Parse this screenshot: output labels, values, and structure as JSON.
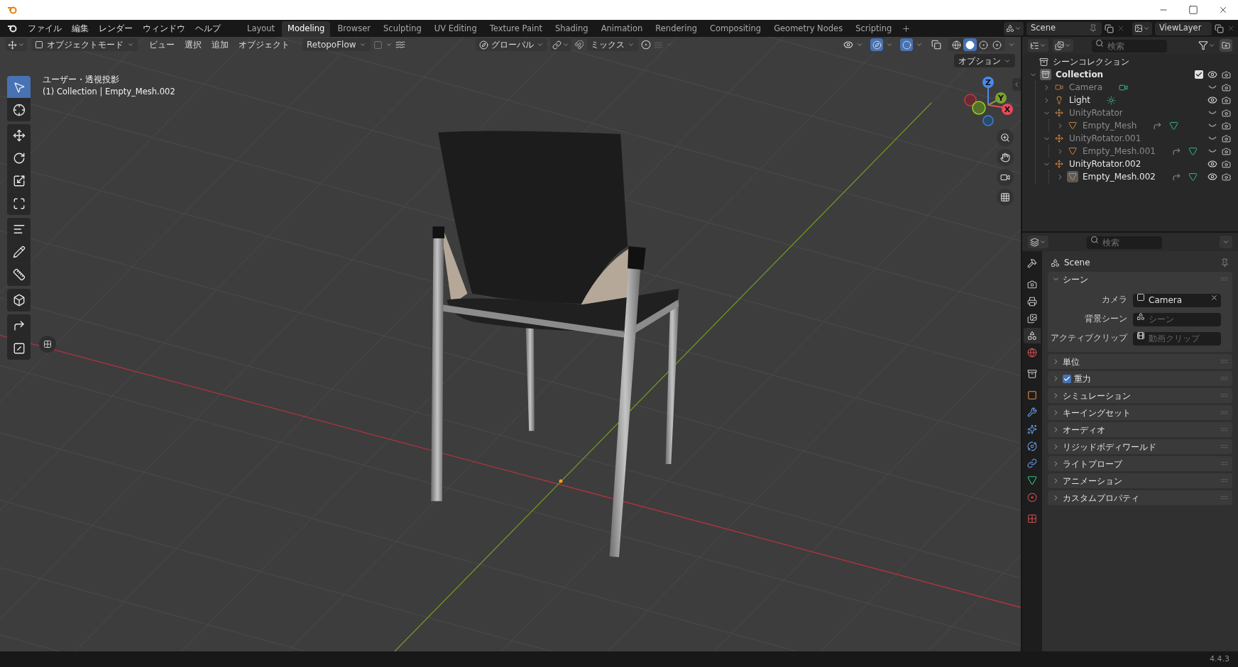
{
  "title_bar": {
    "controls": [
      {
        "kind": "minimize"
      },
      {
        "kind": "maximize"
      },
      {
        "kind": "close"
      }
    ]
  },
  "menu_bar": {
    "items": [
      "ファイル",
      "編集",
      "レンダー",
      "ウィンドウ",
      "ヘルプ"
    ]
  },
  "workspace_tabs": [
    {
      "label": "Layout",
      "selected": false
    },
    {
      "label": "Modeling",
      "selected": true
    },
    {
      "label": "Browser",
      "selected": false
    },
    {
      "label": "Sculpting",
      "selected": false
    },
    {
      "label": "UV Editing",
      "selected": false
    },
    {
      "label": "Texture Paint",
      "selected": false
    },
    {
      "label": "Shading",
      "selected": false
    },
    {
      "label": "Animation",
      "selected": false
    },
    {
      "label": "Rendering",
      "selected": false
    },
    {
      "label": "Compositing",
      "selected": false
    },
    {
      "label": "Geometry Nodes",
      "selected": false
    },
    {
      "label": "Scripting",
      "selected": false
    }
  ],
  "scene_selector": {
    "value": "Scene"
  },
  "view_layer_selector": {
    "value": "ViewLayer"
  },
  "viewport_header": {
    "mode": "オブジェクトモード",
    "menus": [
      "ビュー",
      "選択",
      "追加",
      "オブジェクト"
    ],
    "addon_menu": "RetopoFlow",
    "orientation": "グローバル",
    "pivot": "ミックス",
    "shading_modes": [
      {
        "kind": "wireframe",
        "selected": false
      },
      {
        "kind": "solid",
        "selected": true
      },
      {
        "kind": "material",
        "selected": false
      },
      {
        "kind": "rendered",
        "selected": false
      }
    ]
  },
  "viewport": {
    "view_name": "ユーザー・透視投影",
    "context": "(1) Collection | Empty_Mesh.002",
    "options": "オプション",
    "tool_groups": [
      [
        {
          "kind": "select",
          "selected": true
        },
        {
          "kind": "cursor",
          "selected": false
        }
      ],
      [
        {
          "kind": "move",
          "selected": false
        },
        {
          "kind": "rotate",
          "selected": false
        },
        {
          "kind": "scale",
          "selected": false
        },
        {
          "kind": "transform",
          "selected": false
        }
      ],
      [
        {
          "kind": "align",
          "selected": false
        },
        {
          "kind": "annotate",
          "selected": false
        },
        {
          "kind": "measure",
          "selected": false
        }
      ],
      [
        {
          "kind": "add_cube",
          "selected": false
        }
      ],
      [
        {
          "kind": "corner",
          "selected": false
        },
        {
          "kind": "split",
          "selected": false
        }
      ]
    ],
    "gizmo": {
      "x": "X",
      "y": "Y",
      "z": "Z"
    }
  },
  "outliner": {
    "search_placeholder": "検索",
    "root": "シーンコレクション",
    "tree": [
      {
        "name": "Collection",
        "kind": "collection",
        "expanded": true,
        "checked": true,
        "visible": true,
        "active": true,
        "children": [
          {
            "name": "Camera",
            "kind": "camera",
            "expanded": false,
            "visible": false,
            "active": false
          },
          {
            "name": "Light",
            "kind": "light",
            "expanded": false,
            "visible": true,
            "active": false
          },
          {
            "name": "UnityRotator",
            "kind": "empty",
            "expanded": true,
            "visible": false,
            "active": false,
            "children": [
              {
                "name": "Empty_Mesh",
                "kind": "mesh",
                "expanded": false,
                "visible": false,
                "active": false
              }
            ]
          },
          {
            "name": "UnityRotator.001",
            "kind": "empty",
            "expanded": true,
            "visible": false,
            "active": false,
            "children": [
              {
                "name": "Empty_Mesh.001",
                "kind": "mesh",
                "expanded": false,
                "visible": false,
                "active": false
              }
            ]
          },
          {
            "name": "UnityRotator.002",
            "kind": "empty",
            "expanded": true,
            "visible": true,
            "active": false,
            "children": [
              {
                "name": "Empty_Mesh.002",
                "kind": "mesh",
                "expanded": false,
                "visible": true,
                "active": true
              }
            ]
          }
        ]
      }
    ]
  },
  "properties": {
    "search_placeholder": "検索",
    "context": "Scene",
    "tab_groups": [
      [
        {
          "kind": "tool",
          "selected": false
        }
      ],
      [
        {
          "kind": "render",
          "selected": false
        },
        {
          "kind": "output",
          "selected": false
        },
        {
          "kind": "view_layer",
          "selected": false
        },
        {
          "kind": "scene",
          "selected": true
        },
        {
          "kind": "world",
          "selected": false
        }
      ],
      [
        {
          "kind": "collection",
          "selected": false
        }
      ],
      [
        {
          "kind": "object",
          "selected": false
        },
        {
          "kind": "modifier",
          "selected": false
        },
        {
          "kind": "particles",
          "selected": false
        },
        {
          "kind": "physics",
          "selected": false
        },
        {
          "kind": "constraints",
          "selected": false
        },
        {
          "kind": "data",
          "selected": false
        },
        {
          "kind": "material",
          "selected": false
        }
      ],
      [
        {
          "kind": "texture",
          "selected": false
        }
      ]
    ],
    "panels": [
      {
        "title": "シーン",
        "expanded": true,
        "fields": [
          {
            "label": "カメラ",
            "kind": "camera",
            "value": "Camera"
          },
          {
            "label": "背景シーン",
            "kind": "scene",
            "placeholder": "シーン"
          },
          {
            "label": "アクティブクリップ",
            "kind": "clip",
            "placeholder": "動画クリップ"
          }
        ]
      },
      {
        "title": "単位",
        "expanded": false
      },
      {
        "title": "重力",
        "expanded": false,
        "checked": true
      },
      {
        "title": "シミュレーション",
        "expanded": false
      },
      {
        "title": "キーイングセット",
        "expanded": false
      },
      {
        "title": "オーディオ",
        "expanded": false
      },
      {
        "title": "リジッドボディワールド",
        "expanded": false
      },
      {
        "title": "ライトプローブ",
        "expanded": false
      },
      {
        "title": "アニメーション",
        "expanded": false
      },
      {
        "title": "カスタムプロパティ",
        "expanded": false
      }
    ]
  },
  "status_bar": {
    "version": "4.4.3"
  }
}
